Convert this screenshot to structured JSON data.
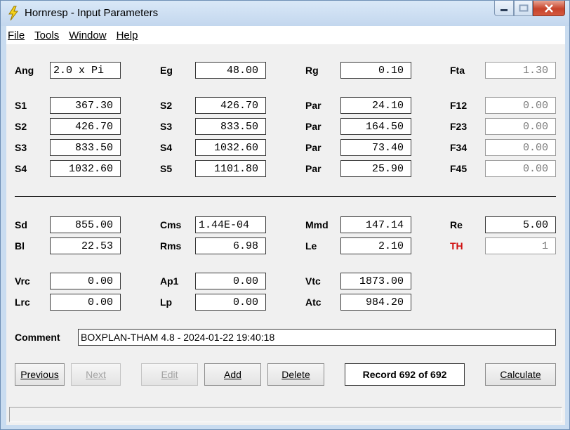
{
  "window": {
    "title": "Hornresp - Input Parameters",
    "icon": "lightning-bolt-icon"
  },
  "menu": [
    {
      "label": "File"
    },
    {
      "label": "Tools"
    },
    {
      "label": "Window"
    },
    {
      "label": "Help"
    }
  ],
  "params": {
    "Ang": {
      "label": "Ang",
      "value": "2.0 x Pi"
    },
    "Eg": {
      "label": "Eg",
      "value": "48.00"
    },
    "Rg": {
      "label": "Rg",
      "value": "0.10"
    },
    "Fta": {
      "label": "Fta",
      "value": "1.30"
    },
    "row1": {
      "s_left_label": "S1",
      "s_left": "367.30",
      "s_right_label": "S2",
      "s_right": "426.70",
      "par_label": "Par",
      "par": "24.10",
      "f_label": "F12",
      "f": "0.00"
    },
    "row2": {
      "s_left_label": "S2",
      "s_left": "426.70",
      "s_right_label": "S3",
      "s_right": "833.50",
      "par_label": "Par",
      "par": "164.50",
      "f_label": "F23",
      "f": "0.00"
    },
    "row3": {
      "s_left_label": "S3",
      "s_left": "833.50",
      "s_right_label": "S4",
      "s_right": "1032.60",
      "par_label": "Par",
      "par": "73.40",
      "f_label": "F34",
      "f": "0.00"
    },
    "row4": {
      "s_left_label": "S4",
      "s_left": "1032.60",
      "s_right_label": "S5",
      "s_right": "1101.80",
      "par_label": "Par",
      "par": "25.90",
      "f_label": "F45",
      "f": "0.00"
    }
  },
  "driver": {
    "Sd": {
      "label": "Sd",
      "value": "855.00"
    },
    "Cms": {
      "label": "Cms",
      "value": "1.44E-04"
    },
    "Mmd": {
      "label": "Mmd",
      "value": "147.14"
    },
    "Re": {
      "label": "Re",
      "value": "5.00"
    },
    "Bl": {
      "label": "Bl",
      "value": "22.53"
    },
    "Rms": {
      "label": "Rms",
      "value": "6.98"
    },
    "Le": {
      "label": "Le",
      "value": "2.10"
    },
    "TH": {
      "label": "TH",
      "value": "1",
      "color": "#d01010"
    }
  },
  "chambers": {
    "Vrc": {
      "label": "Vrc",
      "value": "0.00"
    },
    "Ap1": {
      "label": "Ap1",
      "value": "0.00"
    },
    "Vtc": {
      "label": "Vtc",
      "value": "1873.00"
    },
    "Lrc": {
      "label": "Lrc",
      "value": "0.00"
    },
    "Lp": {
      "label": "Lp",
      "value": "0.00"
    },
    "Atc": {
      "label": "Atc",
      "value": "984.20"
    }
  },
  "comment": {
    "label": "Comment",
    "value": "BOXPLAN-THAM 4.8 - 2024-01-22 19:40:18"
  },
  "buttons": {
    "previous": "Previous",
    "next": "Next",
    "edit": "Edit",
    "add": "Add",
    "delete": "Delete",
    "record": "Record 692 of 692",
    "calculate": "Calculate"
  }
}
